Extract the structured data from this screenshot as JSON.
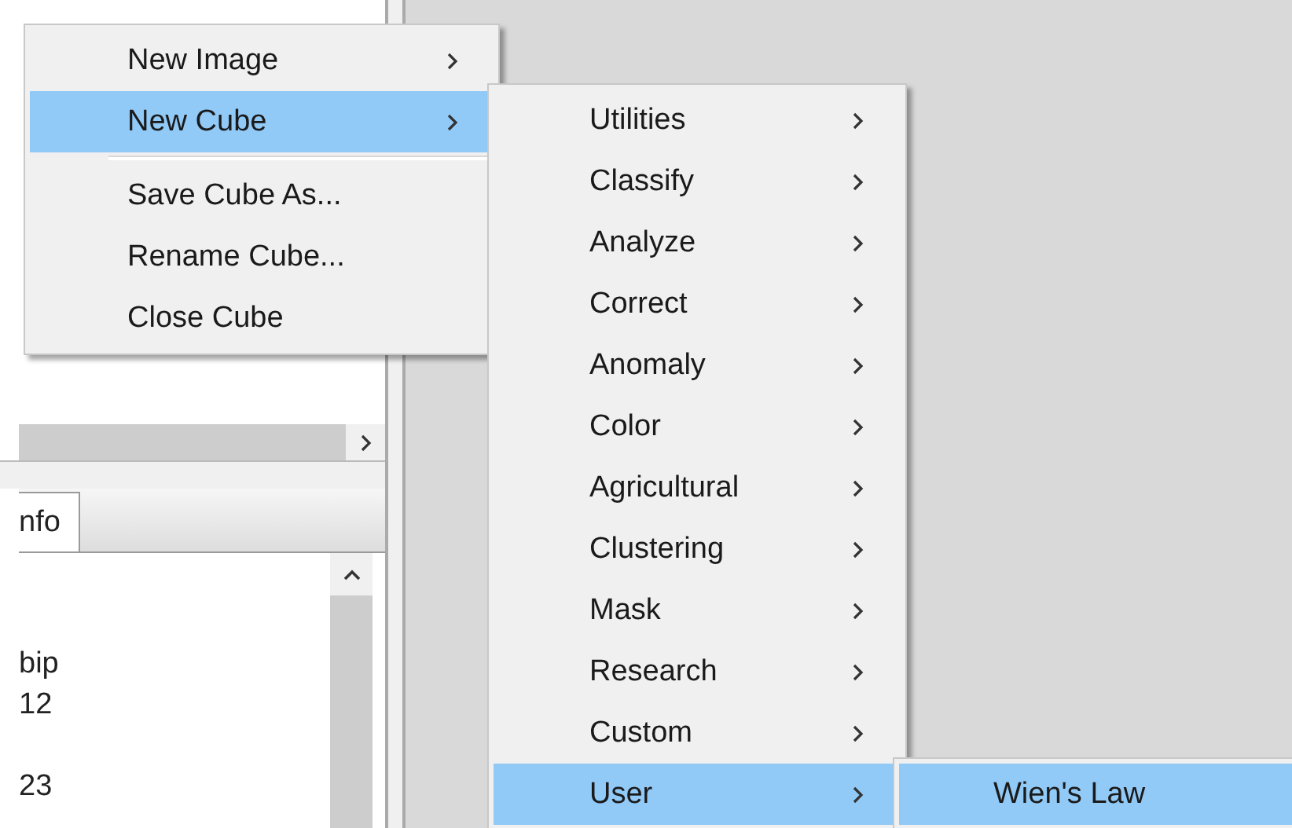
{
  "info_panel": {
    "tab": {
      "label": "nfo",
      "selected": true
    },
    "lines": [
      "bip",
      "12",
      "23"
    ]
  },
  "file_menu": {
    "items": [
      {
        "kind": "item",
        "label": "New Image",
        "submenu": true,
        "selected": false
      },
      {
        "kind": "item",
        "label": "New Cube",
        "submenu": true,
        "selected": true
      },
      {
        "kind": "separator"
      },
      {
        "kind": "item",
        "label": "Save Cube As...",
        "submenu": false,
        "selected": false
      },
      {
        "kind": "item",
        "label": "Rename Cube...",
        "submenu": false,
        "selected": false
      },
      {
        "kind": "item",
        "label": "Close Cube",
        "submenu": false,
        "selected": false
      }
    ]
  },
  "new_cube_menu": {
    "items": [
      {
        "kind": "item",
        "label": "Utilities",
        "submenu": true,
        "selected": false
      },
      {
        "kind": "item",
        "label": "Classify",
        "submenu": true,
        "selected": false
      },
      {
        "kind": "item",
        "label": "Analyze",
        "submenu": true,
        "selected": false
      },
      {
        "kind": "item",
        "label": "Correct",
        "submenu": true,
        "selected": false
      },
      {
        "kind": "item",
        "label": "Anomaly",
        "submenu": true,
        "selected": false
      },
      {
        "kind": "item",
        "label": "Color",
        "submenu": true,
        "selected": false
      },
      {
        "kind": "item",
        "label": "Agricultural",
        "submenu": true,
        "selected": false
      },
      {
        "kind": "item",
        "label": "Clustering",
        "submenu": true,
        "selected": false
      },
      {
        "kind": "item",
        "label": "Mask",
        "submenu": true,
        "selected": false
      },
      {
        "kind": "item",
        "label": "Research",
        "submenu": true,
        "selected": false
      },
      {
        "kind": "item",
        "label": "Custom",
        "submenu": true,
        "selected": false
      },
      {
        "kind": "item",
        "label": "User",
        "submenu": true,
        "selected": true
      }
    ]
  },
  "user_menu": {
    "items": [
      {
        "kind": "item",
        "label": "Wien's Law",
        "submenu": false,
        "selected": true
      }
    ]
  }
}
